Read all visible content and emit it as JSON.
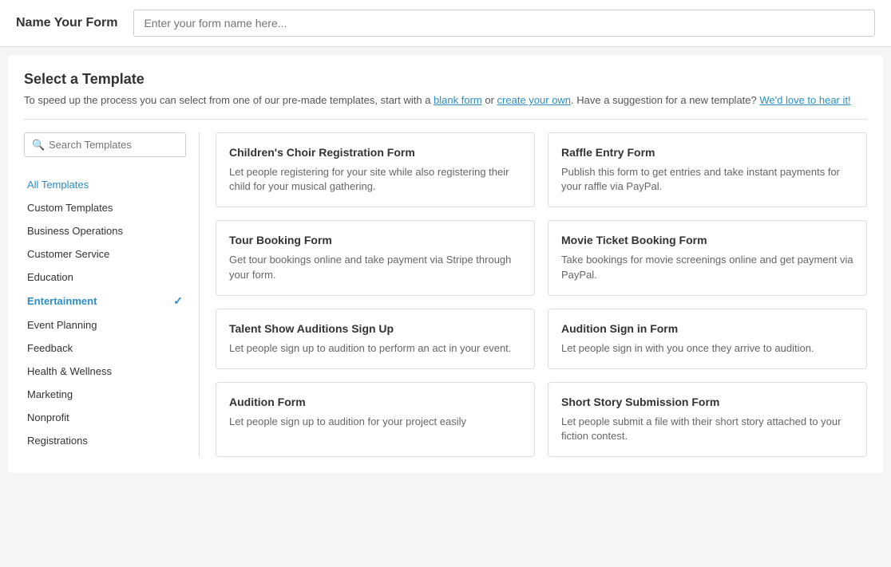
{
  "topBar": {
    "label": "Name Your Form",
    "inputPlaceholder": "Enter your form name here..."
  },
  "selectTemplate": {
    "title": "Select a Template",
    "subtitle": {
      "prefix": "To speed up the process you can select from one of our pre-made templates, start with a ",
      "link1": "blank form",
      "middle": " or ",
      "link2": "create your own",
      "suffix": ". Have a suggestion for a new template? ",
      "link3": "We'd love to hear it!",
      "end": ""
    }
  },
  "searchBox": {
    "placeholder": "Search Templates"
  },
  "navItems": [
    {
      "id": "all-templates",
      "label": "All Templates",
      "active": false
    },
    {
      "id": "custom-templates",
      "label": "Custom Templates",
      "active": false
    },
    {
      "id": "business-operations",
      "label": "Business Operations",
      "active": false
    },
    {
      "id": "customer-service",
      "label": "Customer Service",
      "active": false
    },
    {
      "id": "education",
      "label": "Education",
      "active": false
    },
    {
      "id": "entertainment",
      "label": "Entertainment",
      "active": true
    },
    {
      "id": "event-planning",
      "label": "Event Planning",
      "active": false
    },
    {
      "id": "feedback",
      "label": "Feedback",
      "active": false
    },
    {
      "id": "health-wellness",
      "label": "Health & Wellness",
      "active": false
    },
    {
      "id": "marketing",
      "label": "Marketing",
      "active": false
    },
    {
      "id": "nonprofit",
      "label": "Nonprofit",
      "active": false
    },
    {
      "id": "registrations",
      "label": "Registrations",
      "active": false
    }
  ],
  "templates": [
    {
      "id": "childrens-choir",
      "title": "Children's Choir Registration Form",
      "description": "Let people registering for your site while also registering their child for your musical gathering."
    },
    {
      "id": "raffle-entry",
      "title": "Raffle Entry Form",
      "description": "Publish this form to get entries and take instant payments for your raffle via PayPal."
    },
    {
      "id": "tour-booking",
      "title": "Tour Booking Form",
      "description": "Get tour bookings online and take payment via Stripe through your form."
    },
    {
      "id": "movie-ticket",
      "title": "Movie Ticket Booking Form",
      "description": "Take bookings for movie screenings online and get payment via PayPal."
    },
    {
      "id": "talent-show",
      "title": "Talent Show Auditions Sign Up",
      "description": "Let people sign up to audition to perform an act in your event."
    },
    {
      "id": "audition-sign-in",
      "title": "Audition Sign in Form",
      "description": "Let people sign in with you once they arrive to audition."
    },
    {
      "id": "audition-form",
      "title": "Audition Form",
      "description": "Let people sign up to audition for your project easily"
    },
    {
      "id": "short-story",
      "title": "Short Story Submission Form",
      "description": "Let people submit a file with their short story attached to your fiction contest."
    }
  ]
}
